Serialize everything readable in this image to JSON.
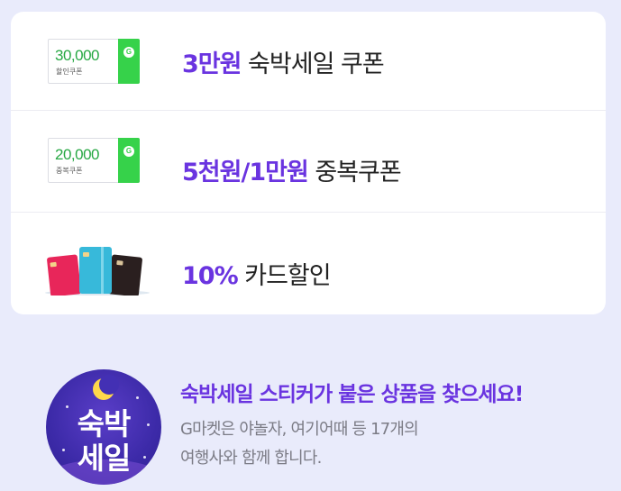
{
  "benefits": [
    {
      "coupon_amount": "30,000",
      "coupon_caption": "할인쿠폰",
      "highlight": "3만원",
      "text": " 숙박세일 쿠폰"
    },
    {
      "coupon_amount": "20,000",
      "coupon_caption": "중복쿠폰",
      "highlight": "5천원/1만원",
      "text": " 중복쿠폰"
    },
    {
      "highlight": "10%",
      "text": " 카드할인"
    }
  ],
  "coupon_logo_letter": "G",
  "badge": {
    "line1": "숙박",
    "line2": "세일"
  },
  "promo": {
    "title": "숙박세일 스티커가 붙은 상품을 찾으세요!",
    "desc_line1": "G마켓은 야놀자, 여기어때 등 17개의",
    "desc_line2": "여행사와 함께 합니다."
  },
  "colors": {
    "background": "#e9ebfb",
    "accent_purple": "#6a34e0",
    "coupon_green": "#36d24a"
  }
}
